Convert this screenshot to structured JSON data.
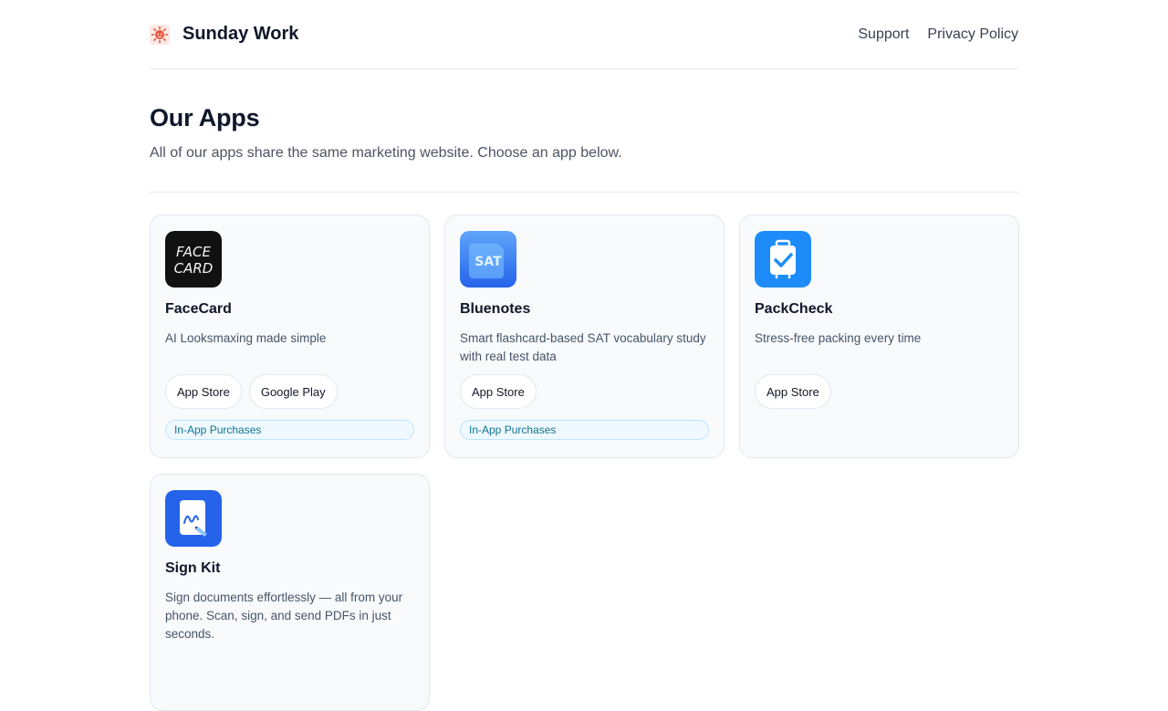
{
  "header": {
    "brand": "Sunday Work",
    "nav": [
      {
        "label": "Support"
      },
      {
        "label": "Privacy Policy"
      }
    ]
  },
  "hero": {
    "title": "Our Apps",
    "subtitle": "All of our apps share the same marketing website. Choose an app below."
  },
  "apps": [
    {
      "name": "FaceCard",
      "icon_text_line1": "FACE",
      "icon_text_line2": "CARD",
      "description": "AI Looksmaxing made simple",
      "stores": [
        "App Store",
        "Google Play"
      ],
      "badge": "In-App Purchases"
    },
    {
      "name": "Bluenotes",
      "icon_text": "SAT",
      "description": "Smart flashcard-based SAT vocabulary study with real test data",
      "stores": [
        "App Store"
      ],
      "badge": "In-App Purchases"
    },
    {
      "name": "PackCheck",
      "description": "Stress-free packing every time",
      "stores": [
        "App Store"
      ]
    },
    {
      "name": "Sign Kit",
      "description": "Sign documents effortlessly — all from your phone. Scan, sign, and send PDFs in just seconds."
    }
  ],
  "colors": {
    "accent_badge_text": "#0e7490",
    "badge_bg": "#f0f9ff",
    "card_bg": "#f8fafc",
    "facecard_icon_bg": "#111111",
    "bluenotes_icon_bg": "#3b82f6",
    "packcheck_icon_bg": "#1d8cf8",
    "signkit_icon_bg": "#2563eb"
  }
}
